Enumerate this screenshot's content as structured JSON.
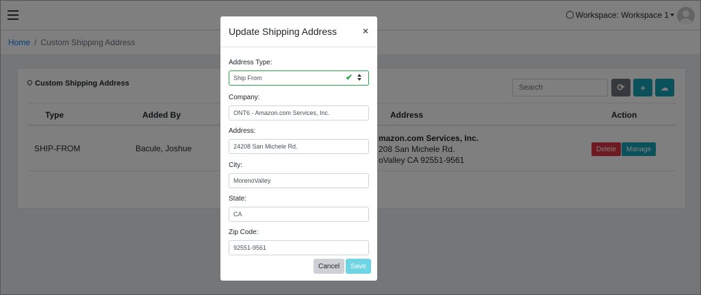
{
  "header": {
    "workspace_label": "Workspace: Workspace 1"
  },
  "breadcrumb": {
    "home": "Home",
    "current": "Custom Shipping Address"
  },
  "card": {
    "title": "Custom Shipping Address",
    "search_placeholder": "Search",
    "refresh_icon": "⟳",
    "add_icon": "+",
    "upload_icon": "☁"
  },
  "table": {
    "headers": [
      "Type",
      "Added By",
      "Address",
      "Action"
    ],
    "rows": [
      {
        "type": "SHIP-FROM",
        "added_by": "Bacule, Joshue",
        "address_line1": "mazon.com Services, Inc.",
        "address_line2": "208 San Michele Rd.",
        "address_line3": "oValley CA 92551-9561",
        "delete_label": "Delete",
        "manage_label": "Manage"
      }
    ]
  },
  "modal": {
    "title": "Update Shipping Address",
    "close_icon": "×",
    "address_type_label": "Address Type:",
    "address_type_value": "Ship From",
    "company_label": "Company:",
    "company_value": "ONT6 - Amazon.com Services, Inc.",
    "address_label": "Address:",
    "address_value": "24208 San Michele Rd.",
    "city_label": "City:",
    "city_value": "MorenoValley",
    "state_label": "State:",
    "state_value": "CA",
    "zip_label": "Zip Code:",
    "zip_value": "92551-9561",
    "cancel_label": "Cancel",
    "save_label": "Save"
  }
}
